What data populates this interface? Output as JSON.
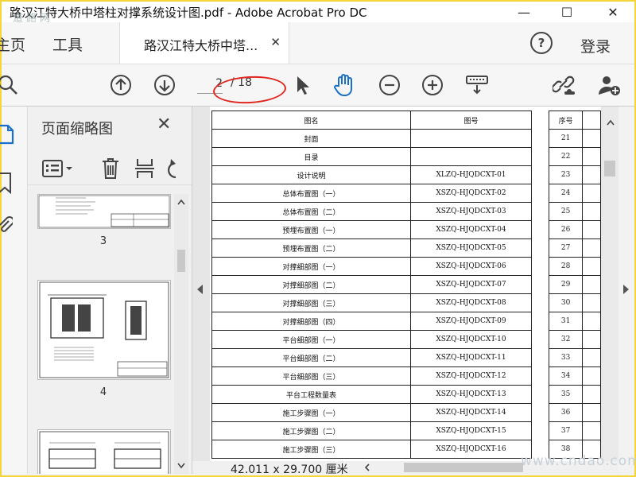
{
  "window": {
    "title": "路汉江特大桥中塔柱对撑系统设计图.pdf - Adobe Acrobat Pro DC",
    "minimize": "—",
    "maximize": "☐",
    "close": "✕"
  },
  "watermark_top": "道路网",
  "watermark_bottom": "www.cndao.com",
  "tabs": {
    "home": "主页",
    "tools": "工具",
    "document": "路汉江特大桥中塔...",
    "close": "✕"
  },
  "header": {
    "help": "?",
    "login": "登录"
  },
  "toolbar": {
    "current_page": "2",
    "total_pages": "/ 18"
  },
  "panel": {
    "title": "页面缩略图",
    "close": "✕",
    "thumbs": [
      {
        "num": "3"
      },
      {
        "num": "4"
      }
    ]
  },
  "status": {
    "page_size": "42.011 x 29.700 厘米"
  },
  "drawing_table": {
    "headers": [
      "图名",
      "图号"
    ],
    "rows": [
      {
        "name": "封面",
        "code": ""
      },
      {
        "name": "目录",
        "code": ""
      },
      {
        "name": "设计说明",
        "code": "XLZQ-HJQDCXT-01"
      },
      {
        "name": "总体布置图（一）",
        "code": "XSZQ-HJQDCXT-02"
      },
      {
        "name": "总体布置图（二）",
        "code": "XSZQ-HJQDCXT-03"
      },
      {
        "name": "预埋布置图（一）",
        "code": "XSZQ-HJQDCXT-04"
      },
      {
        "name": "预埋布置图（二）",
        "code": "XSZQ-HJQDCXT-05"
      },
      {
        "name": "对撑细部图（一）",
        "code": "XSZQ-HJQDCXT-06"
      },
      {
        "name": "对撑细部图（二）",
        "code": "XSZQ-HJQDCXT-07"
      },
      {
        "name": "对撑细部图（三）",
        "code": "XSZQ-HJQDCXT-08"
      },
      {
        "name": "对撑细部图（四）",
        "code": "XSZQ-HJQDCXT-09"
      },
      {
        "name": "平台细部图（一）",
        "code": "XSZQ-HJQDCXT-10"
      },
      {
        "name": "平台细部图（二）",
        "code": "XSZQ-HJQDCXT-11"
      },
      {
        "name": "平台细部图（三）",
        "code": "XSZQ-HJQDCXT-12"
      },
      {
        "name": "平台工程数量表",
        "code": "XSZQ-HJQDCXT-13"
      },
      {
        "name": "施工步骤图（一）",
        "code": "XSZQ-HJQDCXT-14"
      },
      {
        "name": "施工步骤图（二）",
        "code": "XSZQ-HJQDCXT-15"
      },
      {
        "name": "施工步骤图（三）",
        "code": "XSZQ-HJQDCXT-16"
      }
    ]
  },
  "sequence_table": {
    "header": "序号",
    "values": [
      "21",
      "22",
      "23",
      "24",
      "25",
      "26",
      "27",
      "28",
      "29",
      "30",
      "31",
      "32",
      "33",
      "34",
      "35",
      "36",
      "37",
      "38"
    ]
  }
}
